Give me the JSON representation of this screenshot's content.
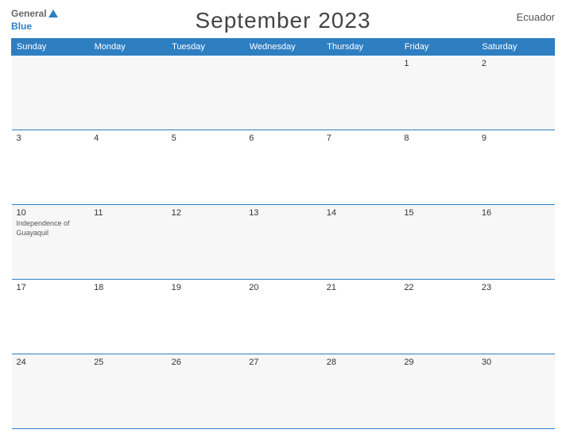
{
  "header": {
    "title": "September 2023",
    "country": "Ecuador",
    "logo_general": "General",
    "logo_blue": "Blue"
  },
  "calendar": {
    "days_of_week": [
      "Sunday",
      "Monday",
      "Tuesday",
      "Wednesday",
      "Thursday",
      "Friday",
      "Saturday"
    ],
    "weeks": [
      [
        {
          "date": "",
          "event": ""
        },
        {
          "date": "",
          "event": ""
        },
        {
          "date": "",
          "event": ""
        },
        {
          "date": "",
          "event": ""
        },
        {
          "date": "",
          "event": ""
        },
        {
          "date": "1",
          "event": ""
        },
        {
          "date": "2",
          "event": ""
        }
      ],
      [
        {
          "date": "3",
          "event": ""
        },
        {
          "date": "4",
          "event": ""
        },
        {
          "date": "5",
          "event": ""
        },
        {
          "date": "6",
          "event": ""
        },
        {
          "date": "7",
          "event": ""
        },
        {
          "date": "8",
          "event": ""
        },
        {
          "date": "9",
          "event": ""
        }
      ],
      [
        {
          "date": "10",
          "event": "Independence of Guayaquil"
        },
        {
          "date": "11",
          "event": ""
        },
        {
          "date": "12",
          "event": ""
        },
        {
          "date": "13",
          "event": ""
        },
        {
          "date": "14",
          "event": ""
        },
        {
          "date": "15",
          "event": ""
        },
        {
          "date": "16",
          "event": ""
        }
      ],
      [
        {
          "date": "17",
          "event": ""
        },
        {
          "date": "18",
          "event": ""
        },
        {
          "date": "19",
          "event": ""
        },
        {
          "date": "20",
          "event": ""
        },
        {
          "date": "21",
          "event": ""
        },
        {
          "date": "22",
          "event": ""
        },
        {
          "date": "23",
          "event": ""
        }
      ],
      [
        {
          "date": "24",
          "event": ""
        },
        {
          "date": "25",
          "event": ""
        },
        {
          "date": "26",
          "event": ""
        },
        {
          "date": "27",
          "event": ""
        },
        {
          "date": "28",
          "event": ""
        },
        {
          "date": "29",
          "event": ""
        },
        {
          "date": "30",
          "event": ""
        }
      ]
    ]
  }
}
